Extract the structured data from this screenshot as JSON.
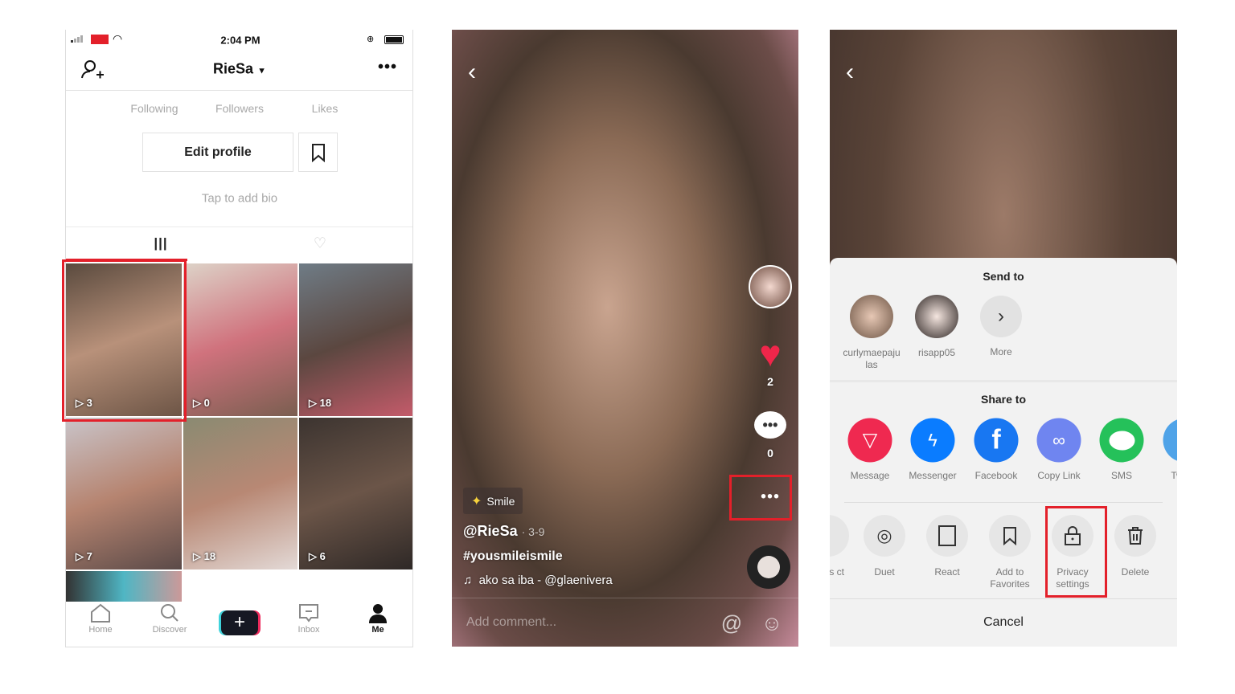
{
  "profile_screen": {
    "status": {
      "time": "2:04 PM"
    },
    "header": {
      "username": "RieSa"
    },
    "stats": [
      {
        "label": "Following"
      },
      {
        "label": "Followers"
      },
      {
        "label": "Likes"
      }
    ],
    "edit_profile_label": "Edit profile",
    "bio_placeholder": "Tap to add bio",
    "videos": [
      {
        "views": "3"
      },
      {
        "views": "0"
      },
      {
        "views": "18"
      },
      {
        "views": "7"
      },
      {
        "views": "18"
      },
      {
        "views": "6"
      }
    ],
    "nav": [
      {
        "label": "Home"
      },
      {
        "label": "Discover"
      },
      {
        "label": "+"
      },
      {
        "label": "Inbox"
      },
      {
        "label": "Me"
      }
    ],
    "accent": "#e3202a"
  },
  "video_screen": {
    "likes": "2",
    "comments": "0",
    "effect": "Smile",
    "author": "@RieSa",
    "date": "· 3-9",
    "caption": "#yousmileismile",
    "music": "ako sa iba - @glaenivera",
    "comment_placeholder": "Add comment..."
  },
  "share_sheet": {
    "send_to_title": "Send to",
    "contacts": [
      {
        "name": "curlymaepaju las"
      },
      {
        "name": "risapp05"
      },
      {
        "name": "More"
      }
    ],
    "share_to_title": "Share to",
    "share_apps": [
      {
        "label": "Message",
        "color": "#ef2950"
      },
      {
        "label": "Messenger",
        "color": "#0a7cff"
      },
      {
        "label": "Facebook",
        "color": "#1877f2"
      },
      {
        "label": "Copy Link",
        "color": "#6f85f0"
      },
      {
        "label": "SMS",
        "color": "#25c15a"
      },
      {
        "label": "Tw",
        "color": "#4fa3e8"
      }
    ],
    "actions": [
      {
        "label": "his ct"
      },
      {
        "label": "Duet"
      },
      {
        "label": "React"
      },
      {
        "label": "Add to Favorites"
      },
      {
        "label": "Privacy settings"
      },
      {
        "label": "Delete"
      }
    ],
    "cancel_label": "Cancel"
  }
}
